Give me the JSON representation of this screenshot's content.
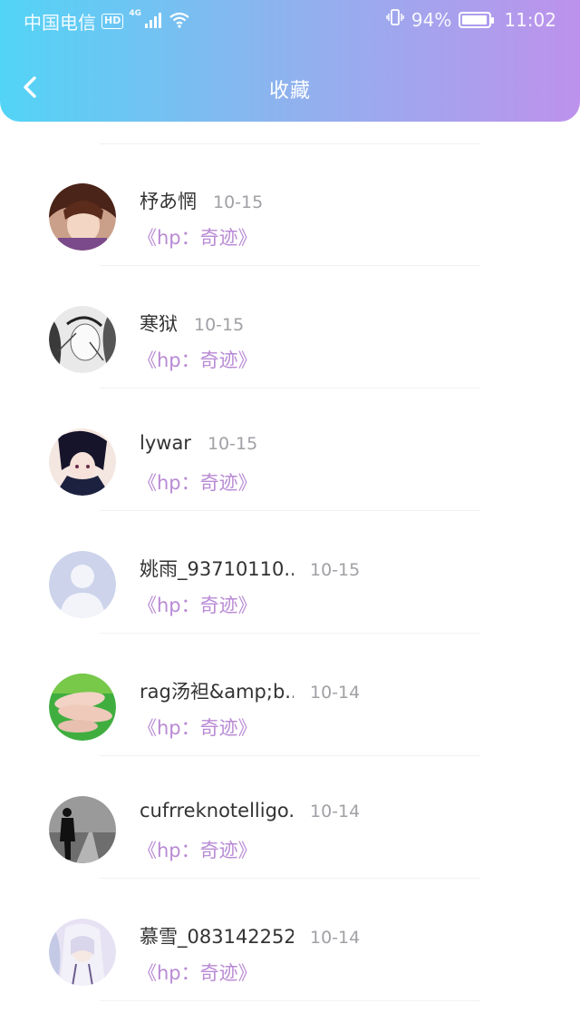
{
  "status_bar": {
    "carrier": "中国电信",
    "hd_badge": "HD",
    "network": "4G",
    "battery_percent": "94%",
    "battery_level": 0.94,
    "time": "11:02"
  },
  "header": {
    "title": "收藏",
    "gradient_start": "#52d4f6",
    "gradient_end": "#bd92ec"
  },
  "favorites": [
    {
      "name": "杼あ惘",
      "date": "10-15",
      "book": "《hp：奇迹》",
      "avatar": "anime-boy-brown"
    },
    {
      "name": "寒狱",
      "date": "10-15",
      "book": "《hp：奇迹》",
      "avatar": "monochrome-sketch"
    },
    {
      "name": "lywar",
      "date": "10-15",
      "book": "《hp：奇迹》",
      "avatar": "anime-boy-dark"
    },
    {
      "name": "姚雨_93710110...",
      "date": "10-15",
      "book": "《hp：奇迹》",
      "avatar": "default-person"
    },
    {
      "name": "rag汤袒&amp;b...",
      "date": "10-14",
      "book": "《hp：奇迹》",
      "avatar": "green-photo"
    },
    {
      "name": "cufrreknotelligo...",
      "date": "10-14",
      "book": "《hp：奇迹》",
      "avatar": "silhouette-photo"
    },
    {
      "name": "慕雪_083142252",
      "date": "10-14",
      "book": "《hp：奇迹》",
      "avatar": "anime-girl-light"
    }
  ],
  "book_color": "#b98ad4"
}
